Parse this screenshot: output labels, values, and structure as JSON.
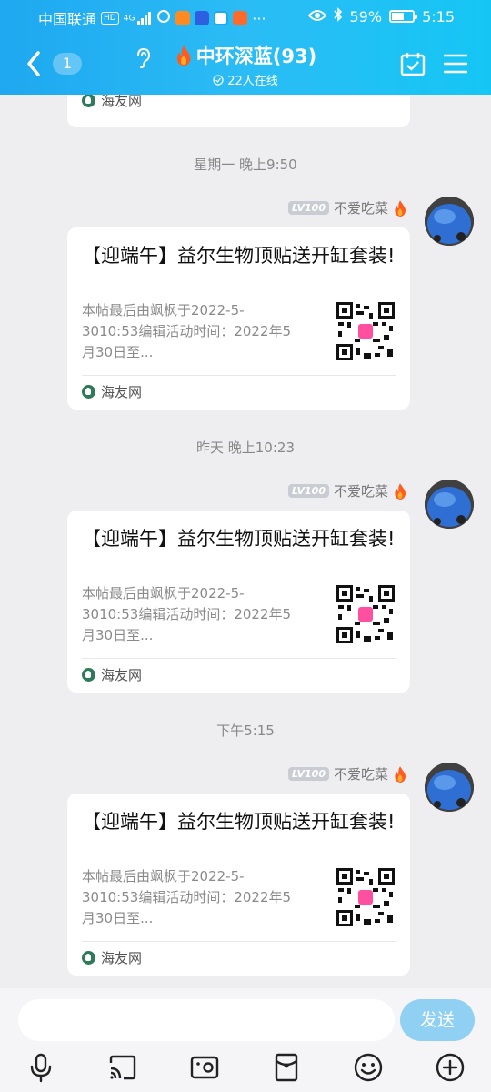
{
  "status_bar": {
    "carrier": "中国联通",
    "hd": "HD",
    "signal_small": "4G",
    "battery": "59%",
    "battery_level": 0.59,
    "time": "5:15"
  },
  "header": {
    "unread_count": "1",
    "group_name": "中环深蓝(93)",
    "online": "22人在线"
  },
  "chat": {
    "top_partial": {
      "source": "海友网"
    },
    "timestamps": [
      "星期一 晚上9:50",
      "昨天 晚上10:23",
      "下午5:15"
    ],
    "messages": [
      {
        "sender": {
          "level": "LV100",
          "name": "不爱吃菜"
        },
        "card": {
          "title": "【迎端午】益尔生物顶贴送开缸套装!",
          "desc": "本帖最后由飒枫于2022-5-3010:53编辑活动时间：2022年5月30日至...",
          "source": "海友网"
        }
      },
      {
        "sender": {
          "level": "LV100",
          "name": "不爱吃菜"
        },
        "card": {
          "title": "【迎端午】益尔生物顶贴送开缸套装!",
          "desc": "本帖最后由飒枫于2022-5-3010:53编辑活动时间：2022年5月30日至...",
          "source": "海友网"
        }
      },
      {
        "sender": {
          "level": "LV100",
          "name": "不爱吃菜"
        },
        "card": {
          "title": "【迎端午】益尔生物顶贴送开缸套装!",
          "desc": "本帖最后由飒枫于2022-5-3010:53编辑活动时间：2022年5月30日至...",
          "source": "海友网"
        }
      }
    ]
  },
  "input_bar": {
    "send_label": "发送",
    "tools": [
      "microphone-icon",
      "screen-share-icon",
      "photo-icon",
      "red-packet-icon",
      "emoji-icon",
      "plus-icon"
    ]
  },
  "colors": {
    "header_start": "#1ea8f0",
    "header_end": "#15c6f5",
    "send_button": "#8fd0f3",
    "fire": "#ff5a1f"
  }
}
